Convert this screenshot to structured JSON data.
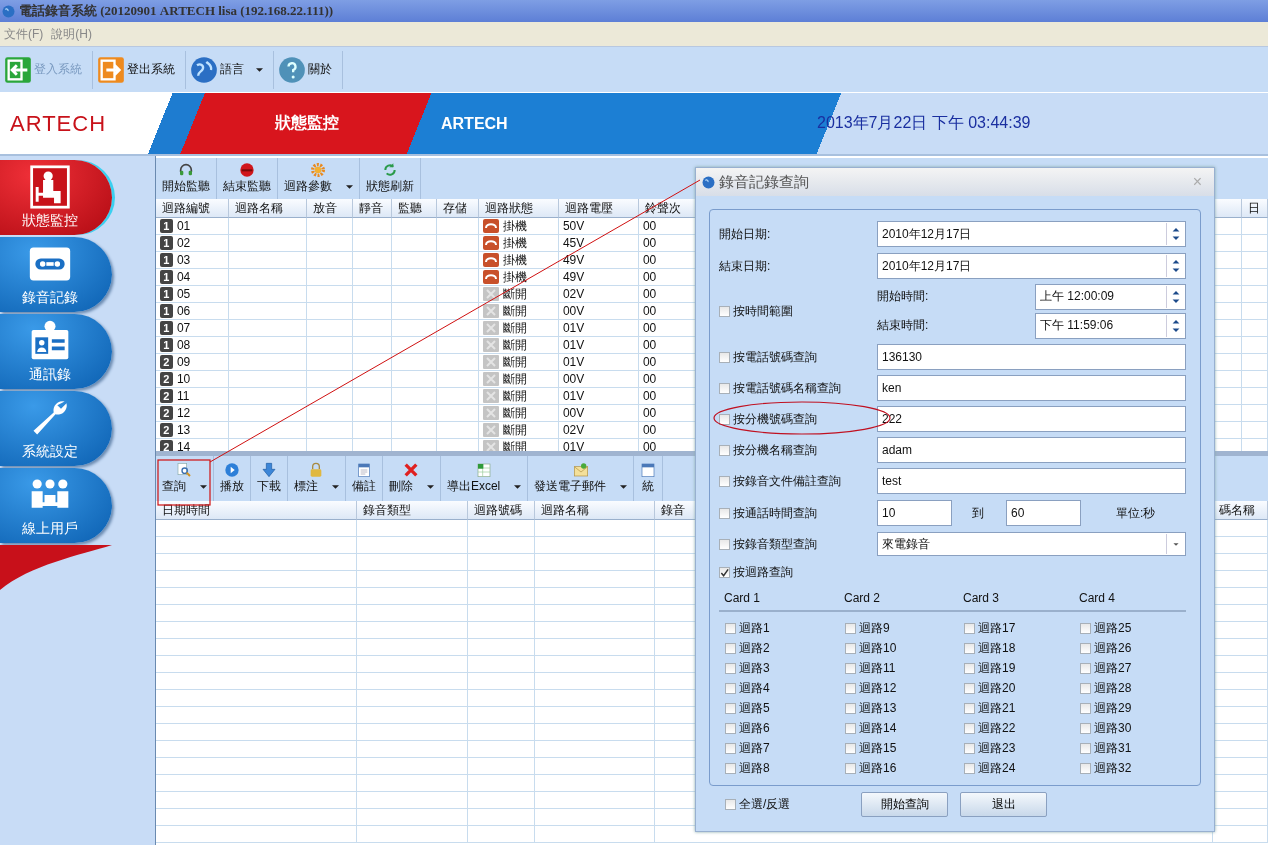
{
  "window": {
    "title": "電話錄音系統 (20120901 ARTECH lisa (192.168.22.111))"
  },
  "menu": [
    "文件(F)",
    "說明(H)"
  ],
  "toolbar": [
    {
      "label": "登入系統",
      "kind": "login",
      "disabled": true,
      "dropdown": false
    },
    {
      "label": "登出系統",
      "kind": "logout",
      "disabled": false,
      "dropdown": false
    },
    {
      "label": "語言",
      "kind": "language",
      "disabled": false,
      "dropdown": true
    },
    {
      "label": "關於",
      "kind": "about",
      "disabled": false,
      "dropdown": false
    }
  ],
  "banner": {
    "logo": "ARTECH",
    "section": "狀態監控",
    "brand": "ARTECH",
    "datetime": "2013年7月22日 下午 03:44:39"
  },
  "sidebar": [
    {
      "label": "狀態監控",
      "kind": "monitor",
      "selected": true
    },
    {
      "label": "錄音記錄",
      "kind": "records",
      "selected": false
    },
    {
      "label": "通訊錄",
      "kind": "contacts",
      "selected": false
    },
    {
      "label": "系統設定",
      "kind": "settings",
      "selected": false
    },
    {
      "label": "線上用戶",
      "kind": "users",
      "selected": false
    }
  ],
  "monitor_toolbar": [
    {
      "label": "開始監聽",
      "kind": "headset",
      "dropdown": false
    },
    {
      "label": "結束監聽",
      "kind": "stop",
      "dropdown": false
    },
    {
      "label": "迴路參數",
      "kind": "gear",
      "dropdown": true
    },
    {
      "label": "狀態刷新",
      "kind": "refresh",
      "dropdown": false
    }
  ],
  "channels": {
    "columns": [
      "迴路編號",
      "迴路名稱",
      "放音",
      "靜音",
      "監聽",
      "存儲",
      "迴路狀態",
      "迴路電壓",
      "鈴聲次",
      "日"
    ],
    "rows": [
      {
        "card": "1",
        "number": "01",
        "kind": "onhook",
        "status": "掛機",
        "voltage": "50V",
        "rings": "00"
      },
      {
        "card": "1",
        "number": "02",
        "kind": "onhook",
        "status": "掛機",
        "voltage": "45V",
        "rings": "00"
      },
      {
        "card": "1",
        "number": "03",
        "kind": "onhook",
        "status": "掛機",
        "voltage": "49V",
        "rings": "00"
      },
      {
        "card": "1",
        "number": "04",
        "kind": "onhook",
        "status": "掛機",
        "voltage": "49V",
        "rings": "00"
      },
      {
        "card": "1",
        "number": "05",
        "kind": "open",
        "status": "斷開",
        "voltage": "02V",
        "rings": "00"
      },
      {
        "card": "1",
        "number": "06",
        "kind": "open",
        "status": "斷開",
        "voltage": "00V",
        "rings": "00"
      },
      {
        "card": "1",
        "number": "07",
        "kind": "open",
        "status": "斷開",
        "voltage": "01V",
        "rings": "00"
      },
      {
        "card": "1",
        "number": "08",
        "kind": "open",
        "status": "斷開",
        "voltage": "01V",
        "rings": "00"
      },
      {
        "card": "2",
        "number": "09",
        "kind": "open",
        "status": "斷開",
        "voltage": "01V",
        "rings": "00"
      },
      {
        "card": "2",
        "number": "10",
        "kind": "open",
        "status": "斷開",
        "voltage": "00V",
        "rings": "00"
      },
      {
        "card": "2",
        "number": "11",
        "kind": "open",
        "status": "斷開",
        "voltage": "01V",
        "rings": "00"
      },
      {
        "card": "2",
        "number": "12",
        "kind": "open",
        "status": "斷開",
        "voltage": "00V",
        "rings": "00"
      },
      {
        "card": "2",
        "number": "13",
        "kind": "open",
        "status": "斷開",
        "voltage": "02V",
        "rings": "00"
      },
      {
        "card": "2",
        "number": "14",
        "kind": "open",
        "status": "斷開",
        "voltage": "01V",
        "rings": "00"
      }
    ]
  },
  "records_toolbar": [
    {
      "label": "查詢",
      "kind": "search",
      "dropdown": true
    },
    {
      "label": "播放",
      "kind": "play",
      "dropdown": false
    },
    {
      "label": "下載",
      "kind": "download",
      "dropdown": false
    },
    {
      "label": "標注",
      "kind": "lock",
      "dropdown": true
    },
    {
      "label": "備註",
      "kind": "note",
      "dropdown": false
    },
    {
      "label": "刪除",
      "kind": "delete",
      "dropdown": true
    },
    {
      "label": "導出Excel",
      "kind": "excel",
      "dropdown": true
    },
    {
      "label": "發送電子郵件",
      "kind": "email",
      "dropdown": true
    },
    {
      "label": "統",
      "kind": "stats",
      "dropdown": false
    }
  ],
  "records": {
    "columns": [
      "日期時間",
      "錄音類型",
      "迴路號碼",
      "迴路名稱",
      "錄音",
      "碼名稱"
    ]
  },
  "dialog": {
    "title": "錄音記錄查詢",
    "close": "×",
    "start_date": {
      "label": "開始日期:",
      "value": "2010年12月17日"
    },
    "end_date": {
      "label": "結束日期:",
      "value": "2010年12月17日"
    },
    "time_range": {
      "label": "按時間範圍",
      "checked": false,
      "start_label": "開始時間:",
      "start_value": "上午 12:00:09",
      "end_label": "結束時間:",
      "end_value": "下午 11:59:06"
    },
    "filters": [
      {
        "label": "按電話號碼查詢",
        "checked": false,
        "value": "136130"
      },
      {
        "label": "按電話號碼名稱查詢",
        "checked": false,
        "value": "ken"
      },
      {
        "label": "按分機號碼查詢",
        "checked": false,
        "value": "222"
      },
      {
        "label": "按分機名稱查詢",
        "checked": false,
        "value": "adam"
      },
      {
        "label": "按錄音文件備註查詢",
        "checked": false,
        "value": "test"
      }
    ],
    "duration": {
      "label": "按通話時間查詢",
      "checked": false,
      "from": "10",
      "to_label": "到",
      "to": "60",
      "unit": "單位:秒"
    },
    "record_type": {
      "label": "按錄音類型查詢",
      "checked": false,
      "value": "來電錄音"
    },
    "by_channel": {
      "label": "按迴路查詢",
      "checked": true
    },
    "cards": [
      {
        "title": "Card 1",
        "channels": [
          {
            "label": "迴路1",
            "checked": false
          },
          {
            "label": "迴路2",
            "checked": false
          },
          {
            "label": "迴路3",
            "checked": false
          },
          {
            "label": "迴路4",
            "checked": false
          },
          {
            "label": "迴路5",
            "checked": false
          },
          {
            "label": "迴路6",
            "checked": false
          },
          {
            "label": "迴路7",
            "checked": false
          },
          {
            "label": "迴路8",
            "checked": false
          }
        ]
      },
      {
        "title": "Card 2",
        "channels": [
          {
            "label": "迴路9",
            "checked": false
          },
          {
            "label": "迴路10",
            "checked": false
          },
          {
            "label": "迴路11",
            "checked": false
          },
          {
            "label": "迴路12",
            "checked": false
          },
          {
            "label": "迴路13",
            "checked": false
          },
          {
            "label": "迴路14",
            "checked": false
          },
          {
            "label": "迴路15",
            "checked": false
          },
          {
            "label": "迴路16",
            "checked": false
          }
        ]
      },
      {
        "title": "Card 3",
        "channels": [
          {
            "label": "迴路17",
            "checked": false
          },
          {
            "label": "迴路18",
            "checked": false
          },
          {
            "label": "迴路19",
            "checked": false
          },
          {
            "label": "迴路20",
            "checked": false
          },
          {
            "label": "迴路21",
            "checked": false
          },
          {
            "label": "迴路22",
            "checked": false
          },
          {
            "label": "迴路23",
            "checked": false
          },
          {
            "label": "迴路24",
            "checked": false
          }
        ]
      },
      {
        "title": "Card 4",
        "channels": [
          {
            "label": "迴路25",
            "checked": false
          },
          {
            "label": "迴路26",
            "checked": false
          },
          {
            "label": "迴路27",
            "checked": false
          },
          {
            "label": "迴路28",
            "checked": false
          },
          {
            "label": "迴路29",
            "checked": false
          },
          {
            "label": "迴路30",
            "checked": false
          },
          {
            "label": "迴路31",
            "checked": false
          },
          {
            "label": "迴路32",
            "checked": false
          }
        ]
      }
    ],
    "select_all": {
      "label": "全選/反選",
      "checked": false
    },
    "buttons": [
      "開始查詢",
      "退出"
    ]
  }
}
